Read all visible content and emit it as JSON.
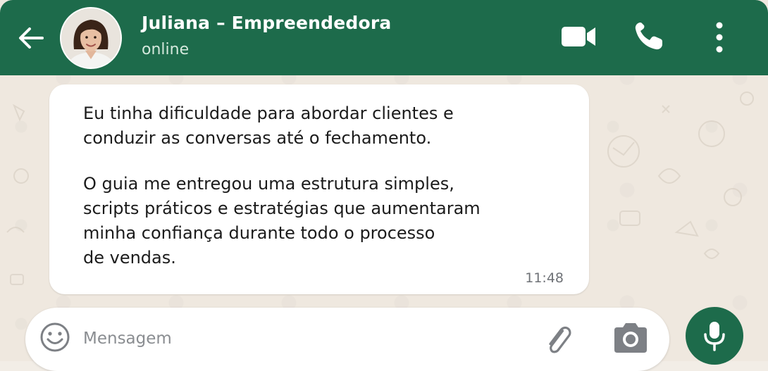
{
  "header": {
    "back_icon": "arrow-left-icon",
    "contact_name": "Juliana – Empreendedora",
    "status": "online",
    "video_icon": "video-camera-icon",
    "call_icon": "phone-icon",
    "menu_icon": "more-vertical-icon",
    "colors": {
      "background": "#1d6b4b",
      "text": "#ffffff"
    }
  },
  "message": {
    "paragraph_1": [
      "Eu tinha dificuldade para abordar clientes e",
      "conduzir as conversas até o fechamento."
    ],
    "paragraph_2": [
      "O guia me entregou uma estrutura simples,",
      "scripts práticos e estratégias que aumentaram",
      "minha confiança durante todo o processo",
      "de vendas."
    ],
    "time": "11:48"
  },
  "composer": {
    "placeholder": "Mensagem",
    "value": "",
    "emoji_icon": "emoji-smile-icon",
    "attach_icon": "paperclip-icon",
    "camera_icon": "camera-icon",
    "mic_icon": "microphone-icon"
  },
  "colors": {
    "chat_background": "#efe8df",
    "bubble": "#ffffff",
    "accent": "#1d6b4b"
  }
}
